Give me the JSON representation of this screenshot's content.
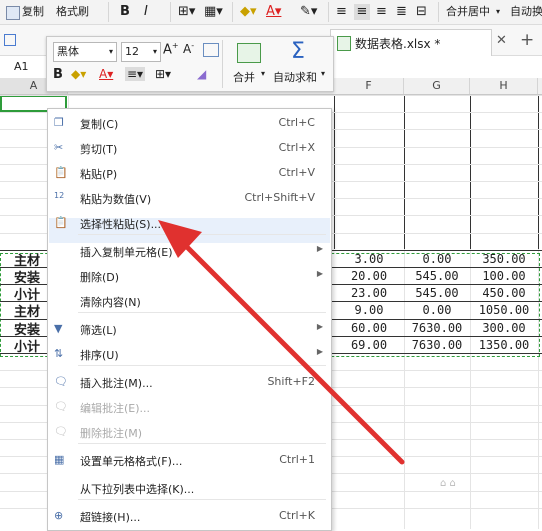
{
  "ribbon": {
    "copy": "复制",
    "format_brush": "格式刷",
    "bold": "B",
    "italic": "I",
    "merge_center": "合并居中",
    "autowrap": "自动换"
  },
  "tabbar": {
    "doc_title": "数据表格.xlsx *",
    "close": "✕",
    "add": "+"
  },
  "formula_bar": {
    "cell_ref": "A1"
  },
  "mini_toolbar": {
    "font_name": "黑体",
    "font_size": "12",
    "bold": "B",
    "merge": "合并",
    "autosum": "自动求和"
  },
  "columns": [
    "A",
    "F",
    "G",
    "H"
  ],
  "rows": [
    {
      "label": "主材",
      "f": "3.00",
      "g": "0.00",
      "h": "350.00"
    },
    {
      "label": "安装",
      "f": "20.00",
      "g": "545.00",
      "h": "100.00"
    },
    {
      "label": "小计",
      "f": "23.00",
      "g": "545.00",
      "h": "450.00"
    },
    {
      "label": "主材",
      "f": "9.00",
      "g": "0.00",
      "h": "1050.00"
    },
    {
      "label": "安装",
      "f": "60.00",
      "g": "7630.00",
      "h": "300.00"
    },
    {
      "label": "小计",
      "f": "69.00",
      "g": "7630.00",
      "h": "1350.00"
    }
  ],
  "context_menu": {
    "items": [
      {
        "label": "复制(C)",
        "shortcut": "Ctrl+C"
      },
      {
        "label": "剪切(T)",
        "shortcut": "Ctrl+X"
      },
      {
        "label": "粘贴(P)",
        "shortcut": "Ctrl+V"
      },
      {
        "label": "粘贴为数值(V)",
        "shortcut": "Ctrl+Shift+V"
      },
      {
        "label": "选择性粘贴(S)...",
        "shortcut": ""
      },
      {
        "label": "插入复制单元格(E)",
        "shortcut": ""
      },
      {
        "label": "删除(D)",
        "shortcut": ""
      },
      {
        "label": "清除内容(N)",
        "shortcut": ""
      },
      {
        "label": "筛选(L)",
        "shortcut": ""
      },
      {
        "label": "排序(U)",
        "shortcut": ""
      },
      {
        "label": "插入批注(M)...",
        "shortcut": "Shift+F2"
      },
      {
        "label": "编辑批注(E)...",
        "shortcut": ""
      },
      {
        "label": "删除批注(M)",
        "shortcut": ""
      },
      {
        "label": "设置单元格格式(F)...",
        "shortcut": "Ctrl+1"
      },
      {
        "label": "从下拉列表中选择(K)...",
        "shortcut": ""
      },
      {
        "label": "超链接(H)...",
        "shortcut": "Ctrl+K"
      }
    ]
  },
  "colors": {
    "accent_red": "#e0312f",
    "dashed_green": "#2e9c3a",
    "menu_highlight": "#e8f0fb"
  }
}
